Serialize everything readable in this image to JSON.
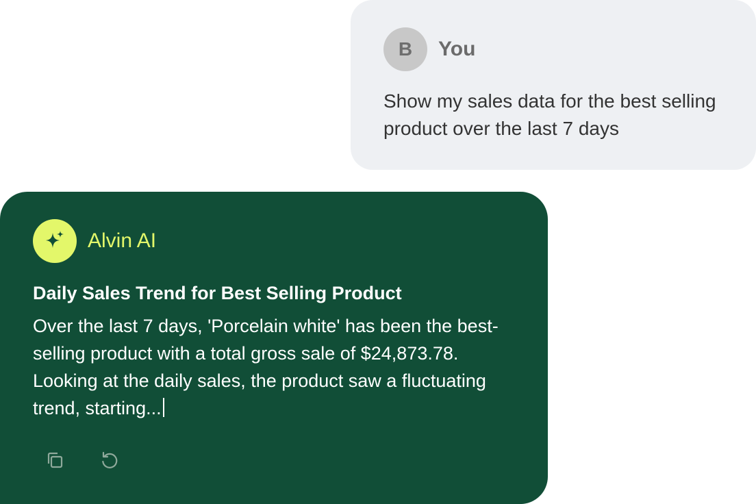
{
  "user_message": {
    "avatar_initial": "B",
    "author": "You",
    "text": "Show my sales data for the best selling product over the last 7 days"
  },
  "ai_message": {
    "author": "Alvin AI",
    "avatar_icon": "sparkle-icon",
    "heading": "Daily Sales Trend for Best Selling Product",
    "body": "Over the last 7 days, 'Porcelain white' has been the best-selling product with a total gross sale of $24,873.78. Looking at the daily sales, the product saw a fluctuating trend, starting...",
    "actions": [
      {
        "icon": "copy-icon"
      },
      {
        "icon": "regenerate-icon"
      }
    ]
  },
  "colors": {
    "user_bubble_bg": "#eef0f3",
    "ai_bubble_bg": "#114e37",
    "accent": "#e3f76a",
    "user_avatar_bg": "#c8c8c8"
  }
}
